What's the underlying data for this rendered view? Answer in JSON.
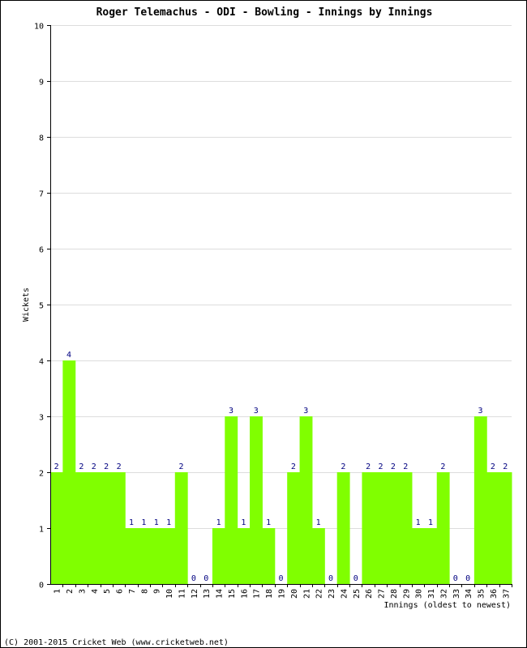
{
  "chart_data": {
    "type": "bar",
    "title": "Roger Telemachus - ODI - Bowling - Innings by Innings",
    "xlabel": "Innings (oldest to newest)",
    "ylabel": "Wickets",
    "ylim": [
      0,
      10
    ],
    "yticks": [
      0,
      1,
      2,
      3,
      4,
      5,
      6,
      7,
      8,
      9,
      10
    ],
    "grid": true,
    "categories": [
      "1",
      "2",
      "3",
      "4",
      "5",
      "6",
      "7",
      "8",
      "9",
      "10",
      "11",
      "12",
      "13",
      "14",
      "15",
      "16",
      "17",
      "18",
      "19",
      "20",
      "21",
      "22",
      "23",
      "24",
      "25",
      "26",
      "27",
      "28",
      "29",
      "30",
      "31",
      "32",
      "33",
      "34",
      "35",
      "36",
      "37"
    ],
    "values": [
      2,
      4,
      2,
      2,
      2,
      2,
      1,
      1,
      1,
      1,
      2,
      0,
      0,
      1,
      3,
      1,
      3,
      1,
      0,
      2,
      3,
      1,
      0,
      2,
      0,
      2,
      2,
      2,
      2,
      1,
      1,
      2,
      0,
      0,
      3,
      2,
      2
    ],
    "bar_color": "#80ff00",
    "label_color": "#000080",
    "grid_color": "#dddddd"
  },
  "footer": "(C) 2001-2015 Cricket Web (www.cricketweb.net)"
}
